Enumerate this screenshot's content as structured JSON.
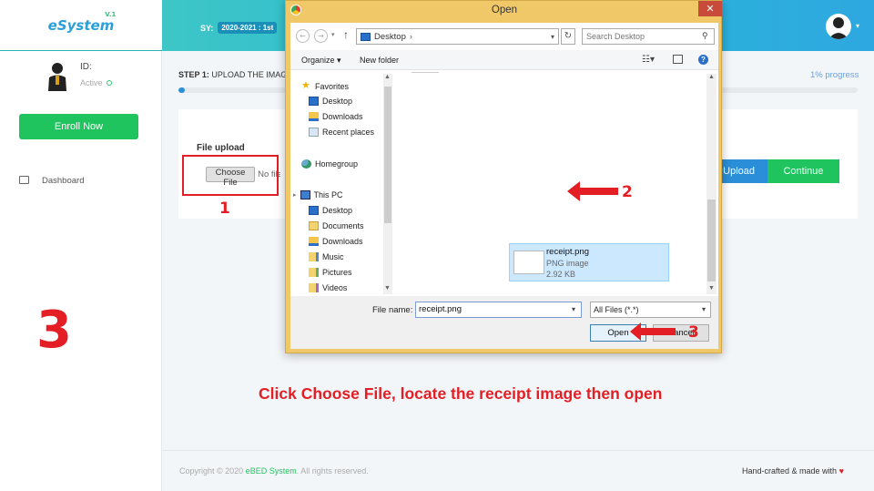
{
  "header": {
    "logo": "eSystem",
    "logo_sup": "V.1",
    "sy_label": "SY:",
    "sy_value": "2020-2021 : 1st"
  },
  "sidebar": {
    "id_label": "ID:",
    "status": "Active",
    "enroll_button": "Enroll Now",
    "nav": [
      {
        "label": "Dashboard",
        "icon": "monitor-icon"
      }
    ]
  },
  "main": {
    "step_prefix": "STEP 1:",
    "step_text": " UPLOAD THE IMAGE",
    "progress_text": "1% progress",
    "progress_percent": 1,
    "file_upload_label": "File upload",
    "choose_file_button": "Choose File",
    "no_file_text": "No file chosen",
    "upload_button": "Upload",
    "continue_button": "Continue"
  },
  "dialog": {
    "title": "Open",
    "close": "✕",
    "address": "Desktop",
    "search_placeholder": "Search Desktop",
    "organize": "Organize ▾",
    "new_folder": "New folder",
    "nav_items": [
      {
        "label": "Favorites",
        "icon": "star-icon"
      },
      {
        "label": "Desktop",
        "icon": "desktop-icon"
      },
      {
        "label": "Downloads",
        "icon": "downloads-icon"
      },
      {
        "label": "Recent places",
        "icon": "recent-places-icon"
      },
      {
        "label": "Homegroup",
        "icon": "homegroup-icon"
      },
      {
        "label": "This PC",
        "icon": "computer-icon"
      },
      {
        "label": "Desktop",
        "icon": "desktop-icon"
      },
      {
        "label": "Documents",
        "icon": "documents-icon"
      },
      {
        "label": "Downloads",
        "icon": "downloads-icon"
      },
      {
        "label": "Music",
        "icon": "music-icon"
      },
      {
        "label": "Pictures",
        "icon": "pictures-icon"
      },
      {
        "label": "Videos",
        "icon": "videos-icon"
      }
    ],
    "file": {
      "name": "receipt.png",
      "type": "PNG image",
      "size": "2.92 KB"
    },
    "file_name_label": "File name:",
    "file_name_value": "receipt.png",
    "file_type_value": "All Files (*.*)",
    "open_button": "Open",
    "cancel_button": "Cancel"
  },
  "annotations": {
    "num1": "1",
    "num2": "2",
    "num3_small": "3",
    "num3_big": "3",
    "instruction": "Click Choose File, locate the receipt image then open",
    "color": "#e31e24"
  },
  "footer": {
    "copyright_prefix": "Copyright © 2020 ",
    "copyright_brand": "eBED System",
    "copyright_suffix": ". All rights reserved.",
    "handcrafted": "Hand-crafted & made with",
    "heart": "♥"
  }
}
